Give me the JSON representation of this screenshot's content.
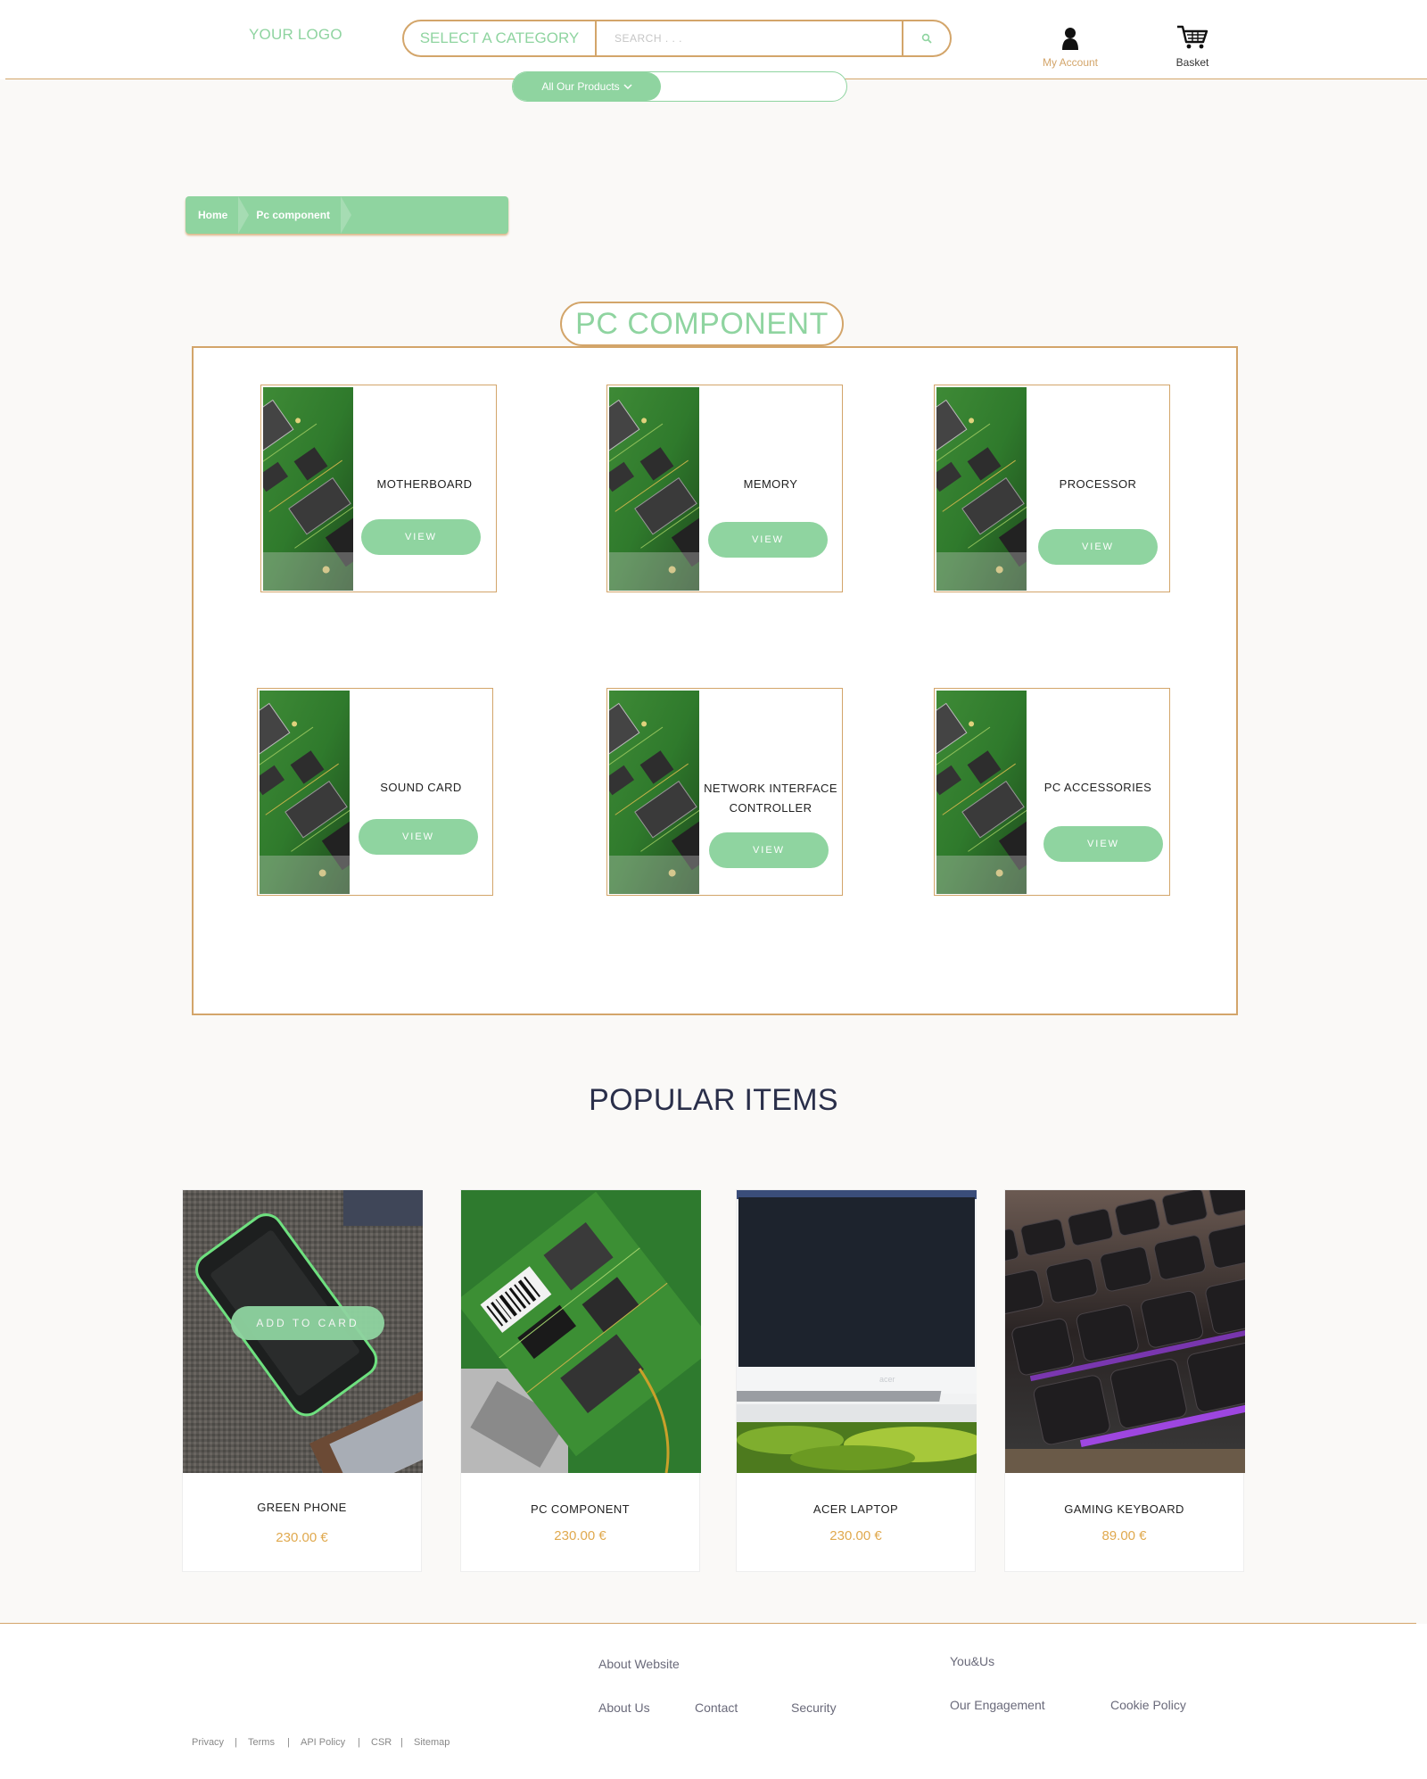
{
  "header": {
    "logo": "YOUR LOGO",
    "category_label": "SELECT A CATEGORY",
    "search_placeholder": "SEARCH . . .",
    "account_label": "My Account",
    "basket_label": "Basket",
    "all_products_label": "All Our Products"
  },
  "breadcrumb": {
    "items": [
      "Home",
      "Pc component"
    ]
  },
  "section": {
    "title": "PC COMPONENT"
  },
  "categories": [
    {
      "name": "MOTHERBOARD",
      "button": "VIEW"
    },
    {
      "name": "MEMORY",
      "button": "VIEW"
    },
    {
      "name": "PROCESSOR",
      "button": "VIEW"
    },
    {
      "name": "SOUND CARD",
      "button": "VIEW"
    },
    {
      "name_line1": "NETWORK INTERFACE",
      "name_line2": "CONTROLLER",
      "button": "VIEW"
    },
    {
      "name": "PC ACCESSORIES",
      "button": "VIEW"
    }
  ],
  "popular": {
    "title": "POPULAR ITEMS",
    "add_button": "ADD TO CARD",
    "items": [
      {
        "name": "GREEN PHONE",
        "price": "230.00 €"
      },
      {
        "name": "PC COMPONENT",
        "price": "230.00 €"
      },
      {
        "name": "ACER LAPTOP",
        "price": "230.00 €"
      },
      {
        "name": "GAMING KEYBOARD",
        "price": "89.00 €"
      }
    ]
  },
  "footer": {
    "about_heading": "About Website",
    "about_us": "About Us",
    "contact": "Contact",
    "security": "Security",
    "you_us": "You&Us",
    "engagement": "Our Engagement",
    "cookie": "Cookie Policy",
    "legal": [
      "Privacy",
      "Terms",
      "API Policy",
      "CSR",
      "Sitemap"
    ],
    "separator": "|"
  },
  "colors": {
    "accent_green": "#8fd4a0",
    "accent_gold": "#d3a56a",
    "price": "#e0a94e",
    "heading": "#2a2f4a"
  }
}
